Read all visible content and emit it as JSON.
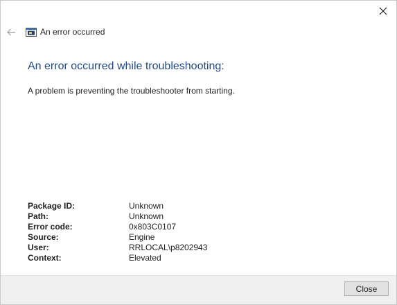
{
  "window": {
    "title": "An error occurred"
  },
  "main": {
    "heading": "An error occurred while troubleshooting:",
    "description": "A problem is preventing the troubleshooter from starting."
  },
  "details": [
    {
      "label": "Package ID:",
      "value": "Unknown"
    },
    {
      "label": "Path:",
      "value": "Unknown"
    },
    {
      "label": "Error code:",
      "value": "0x803C0107"
    },
    {
      "label": "Source:",
      "value": "Engine"
    },
    {
      "label": "User:",
      "value": "RRLOCAL\\p8202943"
    },
    {
      "label": "Context:",
      "value": "Elevated"
    }
  ],
  "footer": {
    "close_label": "Close"
  },
  "icons": {
    "close": "close-icon",
    "back": "back-arrow-icon",
    "app": "troubleshooter-icon"
  },
  "colors": {
    "heading": "#234a84",
    "footer_bg": "#f0f0f0",
    "button_bg": "#e1e1e1"
  }
}
